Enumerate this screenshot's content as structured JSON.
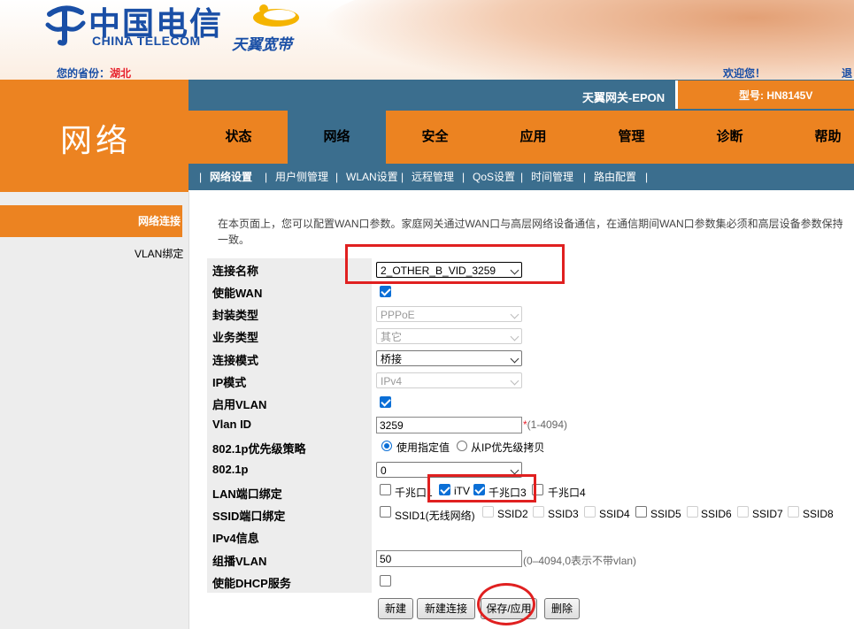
{
  "header": {
    "brand_cn": "中国电信",
    "brand_en": "CHINA TELECOM",
    "tianyi": "天翼宽带",
    "province_label": "您的省份：",
    "province_value": "湖北",
    "welcome": "欢迎您！",
    "logout": "退"
  },
  "topbar": {
    "gateway": "天翼网关-EPON",
    "model": "型号: HN8145V"
  },
  "section_title": "网络",
  "nav": {
    "tabs": [
      "状态",
      "网络",
      "安全",
      "应用",
      "管理",
      "诊断",
      "帮助"
    ],
    "active_index": 1
  },
  "subnav": {
    "items": [
      "网络设置",
      "用户侧管理",
      "WLAN设置",
      "远程管理",
      "QoS设置",
      "时间管理",
      "路由配置"
    ],
    "separator": "|",
    "active_index": 0
  },
  "sidebar": {
    "items": [
      "网络连接",
      "VLAN绑定"
    ],
    "active_index": 0
  },
  "description": {
    "line1": "在本页面上，您可以配置WAN口参数。家庭网关通过WAN口与高层网络设备通信，在通信期间WAN口参数集必须和高层设备参数保持",
    "line2": "一致。"
  },
  "form": {
    "labels": {
      "conn_name": "连接名称",
      "enable_wan": "使能WAN",
      "encap": "封装类型",
      "service": "业务类型",
      "conn_mode": "连接模式",
      "ip_mode": "IP模式",
      "enable_vlan": "启用VLAN",
      "vlan_id": "Vlan ID",
      "prio_policy": "802.1p优先级策略",
      "p8021": "802.1p",
      "lan_bind": "LAN端口绑定",
      "ssid_bind": "SSID端口绑定",
      "ipv4_info": "IPv4信息",
      "mcast_vlan": "组播VLAN",
      "enable_dhcp": "使能DHCP服务"
    },
    "values": {
      "conn_name": "2_OTHER_B_VID_3259",
      "enable_wan": true,
      "encap": "PPPoE",
      "service": "其它",
      "conn_mode": "桥接",
      "ip_mode": "IPv4",
      "enable_vlan": true,
      "vlan_id": "3259",
      "vlan_id_required": "*",
      "vlan_id_hint": "(1-4094)",
      "prio_option_a": "使用指定值",
      "prio_option_b": "从IP优先级拷贝",
      "prio_selected": "使用指定值",
      "p8021": "0",
      "mcast_vlan": "50",
      "mcast_hint": "(0–4094,0表示不带vlan)",
      "enable_dhcp": false
    },
    "lan_ports": [
      {
        "label": "千兆口1",
        "checked": false
      },
      {
        "label": "iTV",
        "checked": true
      },
      {
        "label": "千兆口3",
        "checked": true
      },
      {
        "label": "千兆口4",
        "checked": false
      }
    ],
    "ssids": [
      {
        "label": "SSID1(无线网络)",
        "checked": false,
        "enabled": true
      },
      {
        "label": "SSID2",
        "checked": false,
        "enabled": false
      },
      {
        "label": "SSID3",
        "checked": false,
        "enabled": false
      },
      {
        "label": "SSID4",
        "checked": false,
        "enabled": false
      },
      {
        "label": "SSID5",
        "checked": false,
        "enabled": true
      },
      {
        "label": "SSID6",
        "checked": false,
        "enabled": false
      },
      {
        "label": "SSID7",
        "checked": false,
        "enabled": false
      },
      {
        "label": "SSID8",
        "checked": false,
        "enabled": false
      }
    ]
  },
  "buttons": {
    "new": "新建",
    "new_conn": "新建连接",
    "save": "保存/应用",
    "delete": "删除"
  },
  "colors": {
    "orange": "#ec8321",
    "blue_bar": "#3b6e8e",
    "annotation_red": "#e02020",
    "brand_blue": "#1a4fa6"
  }
}
